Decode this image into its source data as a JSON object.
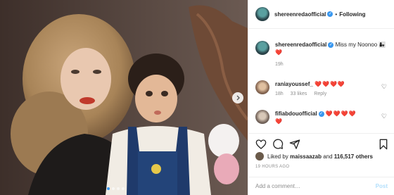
{
  "header": {
    "username": "shereenredaofficial",
    "separator": "•",
    "follow_label": "Following",
    "verified_mark": "✓"
  },
  "caption": {
    "username": "shereenredaofficial",
    "text": "Miss my Noonoo",
    "emoji": "👩‍👧❤️",
    "time": "19h"
  },
  "comments": [
    {
      "username": "raniayoussef_",
      "hearts": "❤️❤️❤️❤️",
      "time": "18h",
      "likes": "33 likes",
      "reply": "Reply"
    },
    {
      "username": "fifiabdouofficial",
      "hearts": "❤️❤️❤️❤️",
      "hearts_line2": "❤️"
    }
  ],
  "likes": {
    "prefix": "Liked by",
    "user": "maissaazab",
    "conj": "and",
    "count": "116,517 others"
  },
  "timestamp": "19 HOURS AGO",
  "add_comment": {
    "placeholder": "Add a comment…",
    "post_label": "Post"
  },
  "icons": {
    "like": "heart-icon",
    "comment": "comment-icon",
    "share": "share-icon",
    "save": "bookmark-icon",
    "next": "chevron-right-icon"
  },
  "carousel": {
    "slides": 4,
    "active": 1
  },
  "colors": {
    "accent": "#3897f0",
    "heart": "#ed4956",
    "muted": "#8e8e8e",
    "post_disabled": "#b2dffc"
  }
}
